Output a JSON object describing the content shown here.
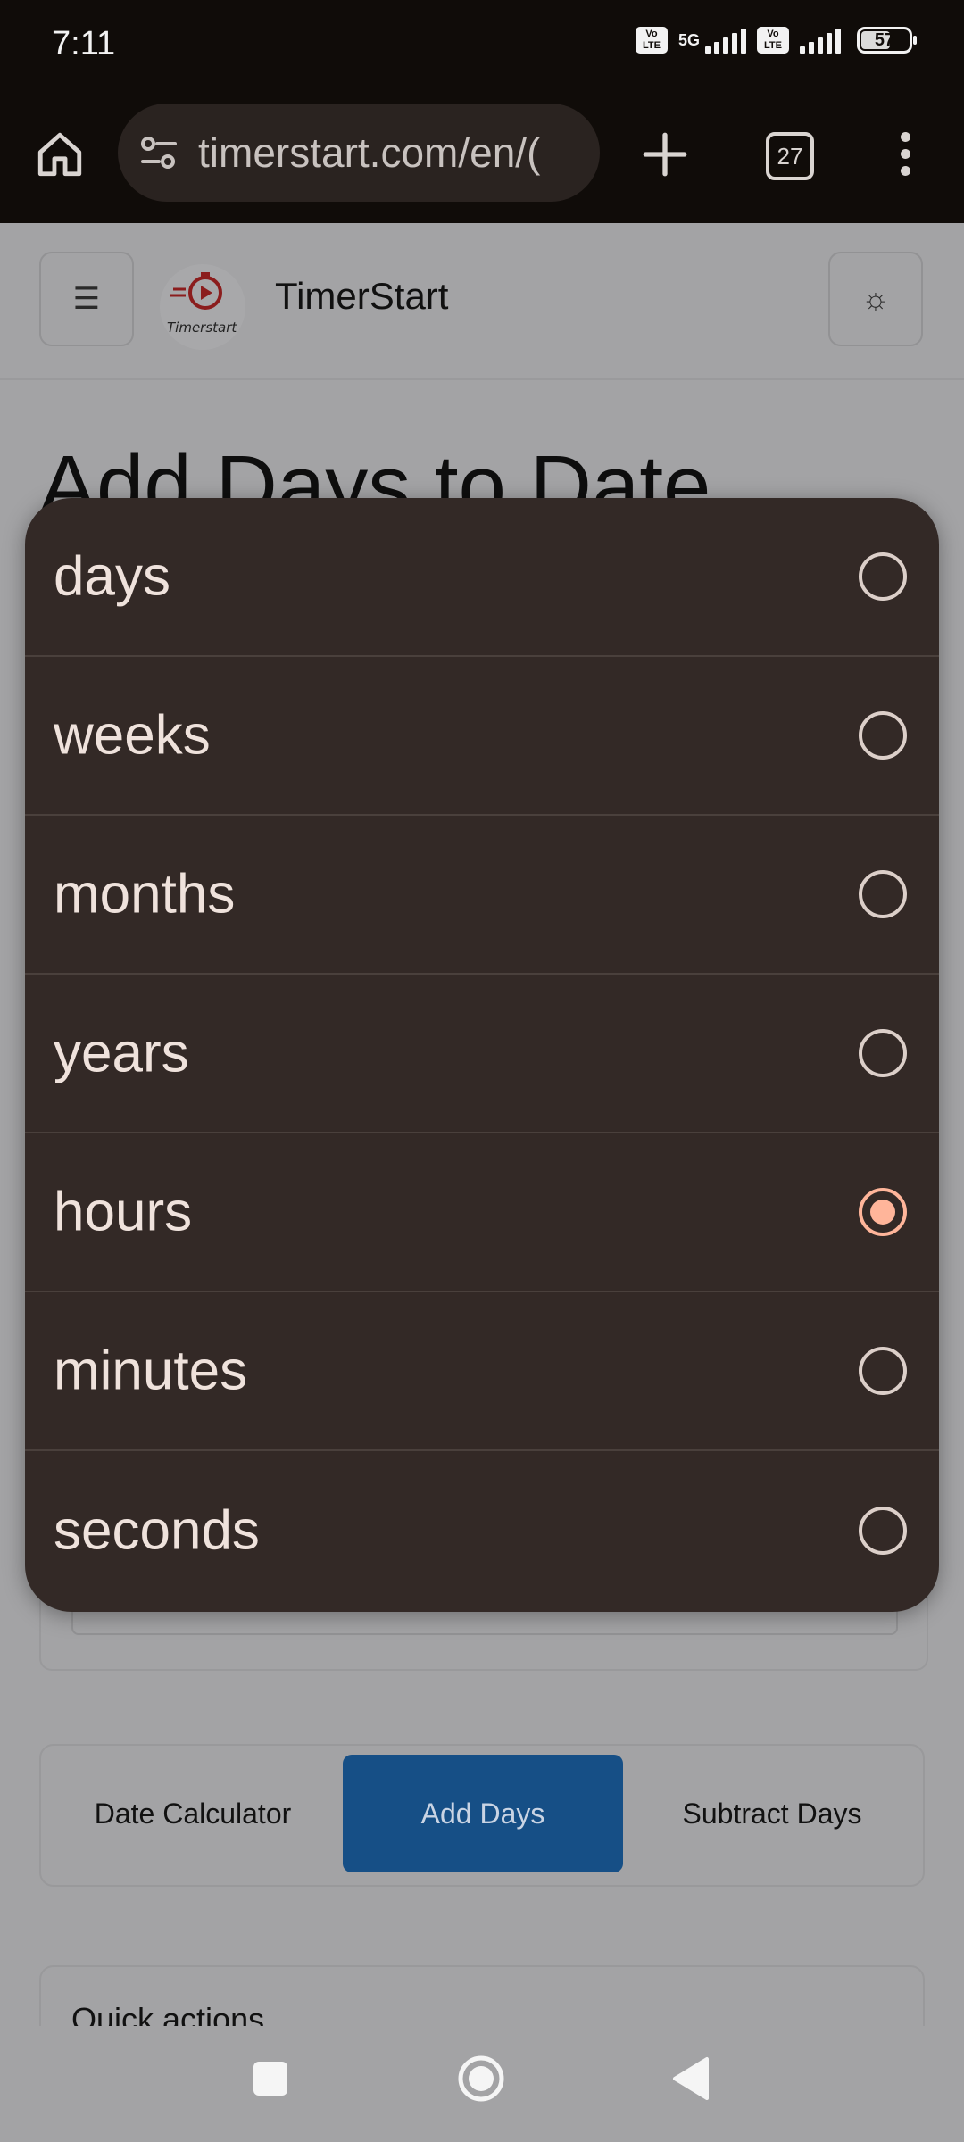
{
  "status_bar": {
    "time": "7:11",
    "network": "5G",
    "volte_label": "Vo LTE",
    "battery": "57"
  },
  "browser": {
    "url": "timerstart.com/en/(",
    "tab_count": "27"
  },
  "site": {
    "brand": "TimerStart",
    "logo_text": "Timerstart",
    "menu_glyph": "☰",
    "theme_glyph": "☼"
  },
  "page": {
    "title": "Add Days to Date"
  },
  "mode_tabs": [
    {
      "label": "Date Calculator",
      "active": false
    },
    {
      "label": "Add Days",
      "active": true
    },
    {
      "label": "Subtract Days",
      "active": false
    }
  ],
  "quick_actions": {
    "title": "Quick actions"
  },
  "unit_picker": {
    "options": [
      "days",
      "weeks",
      "months",
      "years",
      "hours",
      "minutes",
      "seconds"
    ],
    "selected": "hours"
  },
  "colors": {
    "accent": "#ffb59a",
    "popup_bg": "#332926",
    "active_tab": "#164f86"
  },
  "icons": [
    "home-icon",
    "tune-icon",
    "plus-icon",
    "tab-switcher-icon",
    "more-vert-icon",
    "menu-icon",
    "sun-icon",
    "radio-icon"
  ]
}
